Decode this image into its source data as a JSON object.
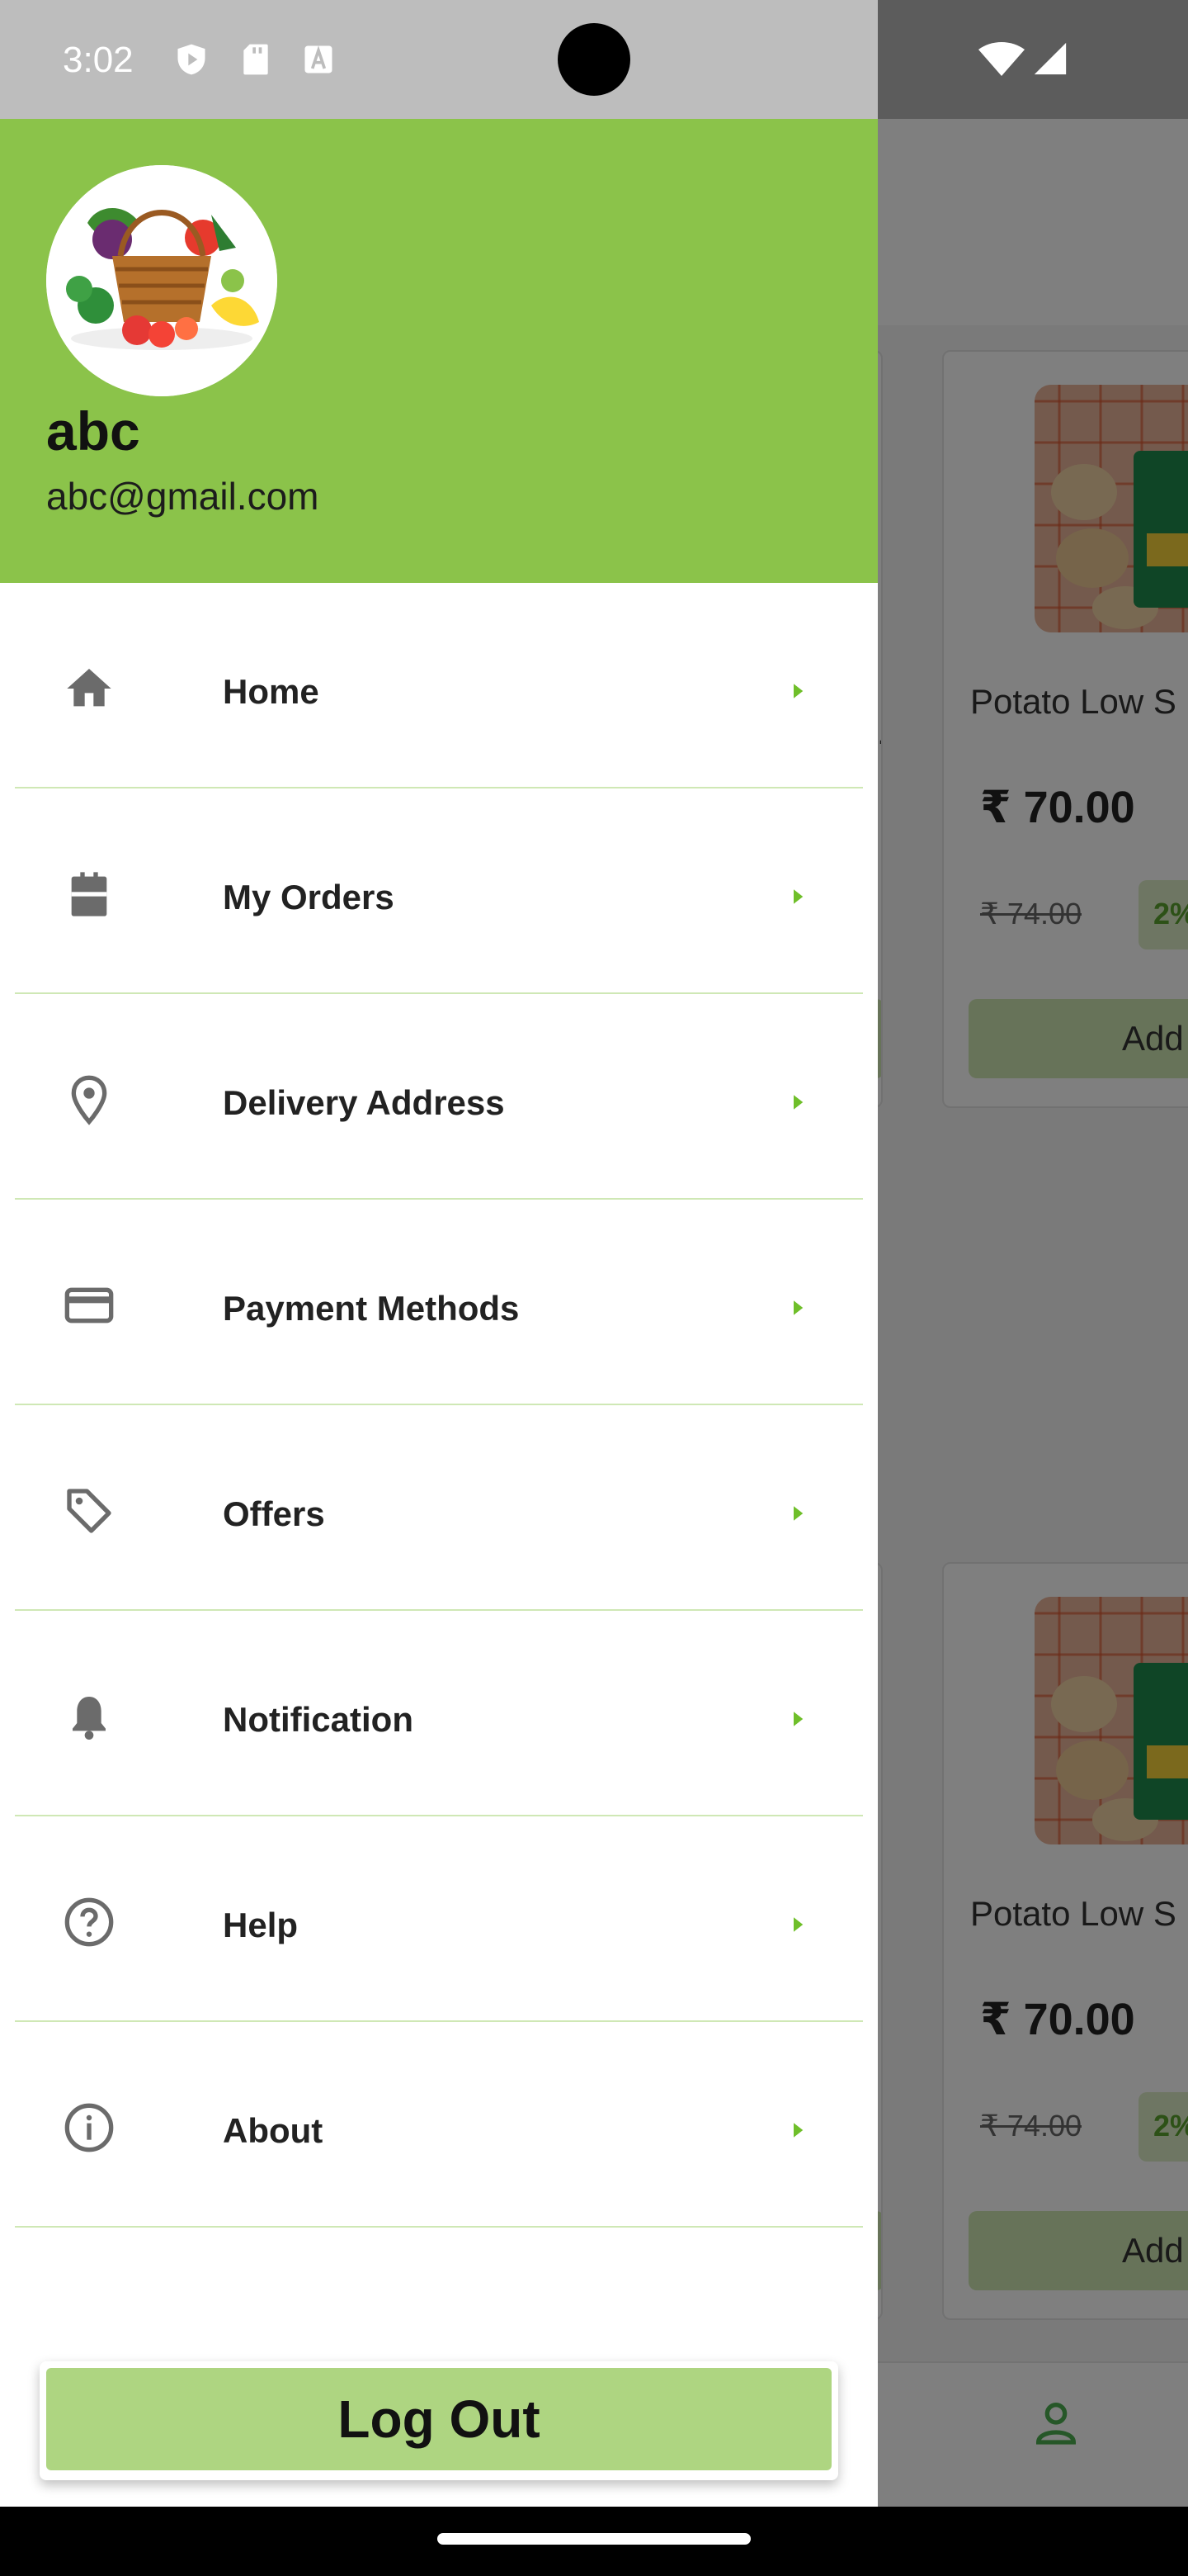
{
  "status_bar": {
    "time": "3:02"
  },
  "drawer": {
    "user": {
      "name": "abc",
      "email": "abc@gmail.com"
    },
    "menu": [
      {
        "label": "Home",
        "icon": "home-icon"
      },
      {
        "label": "My Orders",
        "icon": "orders-icon"
      },
      {
        "label": "Delivery Address",
        "icon": "location-pin-icon"
      },
      {
        "label": "Payment Methods",
        "icon": "credit-card-icon"
      },
      {
        "label": "Offers",
        "icon": "tag-icon"
      },
      {
        "label": "Notification",
        "icon": "bell-icon"
      },
      {
        "label": "Help",
        "icon": "help-circle-icon"
      },
      {
        "label": "About",
        "icon": "info-circle-icon"
      }
    ],
    "logout_label": "Log Out"
  },
  "background": {
    "products": [
      {
        "name": "Potato Low S",
        "price": "₹ 70.00",
        "old_price": "₹ 74.00",
        "discount": "2%",
        "add_label": "Add"
      },
      {
        "name": "Potato Low S",
        "price": "₹ 70.00",
        "old_price": "₹ 74.00",
        "discount": "2%",
        "add_label": "Add"
      }
    ],
    "left_card_ellipsis": "..."
  },
  "colors": {
    "drawer_header": "#8bc34a",
    "accent": "#5aa22f",
    "logout": "#aed581",
    "divider": "#cfe8b5"
  }
}
